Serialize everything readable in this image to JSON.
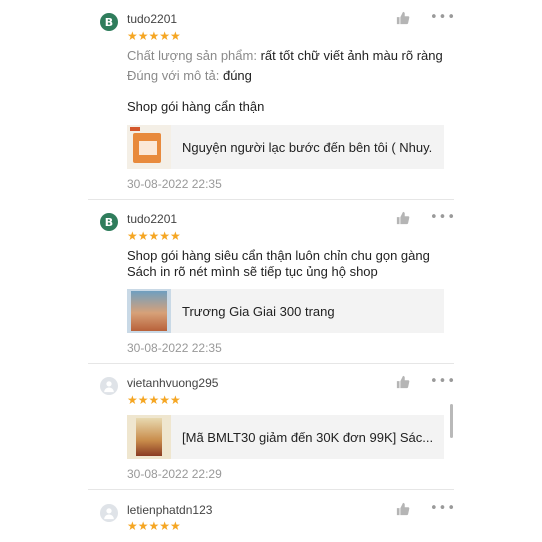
{
  "reviews": [
    {
      "avatar": "B",
      "username": "tudo2201",
      "stars": "★★★★★",
      "attr1_label": "Chất lượng sản phẩm:",
      "attr1_value": "rất tốt chữ viết ảnh màu rõ ràng",
      "attr2_label": "Đúng với mô tả:",
      "attr2_value": "đúng",
      "comment": "Shop gói hàng cẩn thận",
      "product_title": "Nguyện người lạc bước đến bên tôi ( Nhuy...",
      "date": "30-08-2022 22:35"
    },
    {
      "avatar": "B",
      "username": "tudo2201",
      "stars": "★★★★★",
      "comment_line1": "Shop gói hàng siêu cẩn thận luôn chỉn chu gọn gàng",
      "comment_line2": "Sách in rõ nét mình sẽ tiếp tục ủng hộ shop",
      "product_title": "Trương Gia Giai 300 trang",
      "date": "30-08-2022 22:35"
    },
    {
      "username": "vietanhvuong295",
      "stars": "★★★★★",
      "product_title": "[Mã BMLT30 giảm đến 30K đơn 99K] Sác...",
      "date": "30-08-2022 22:29"
    },
    {
      "username": "letienphatdn123",
      "stars": "★★★★★"
    }
  ],
  "icons": {
    "like": "thumbs-up-icon",
    "more": "more-options-icon",
    "star_color": "#f5a623"
  },
  "more_glyph": "•••"
}
